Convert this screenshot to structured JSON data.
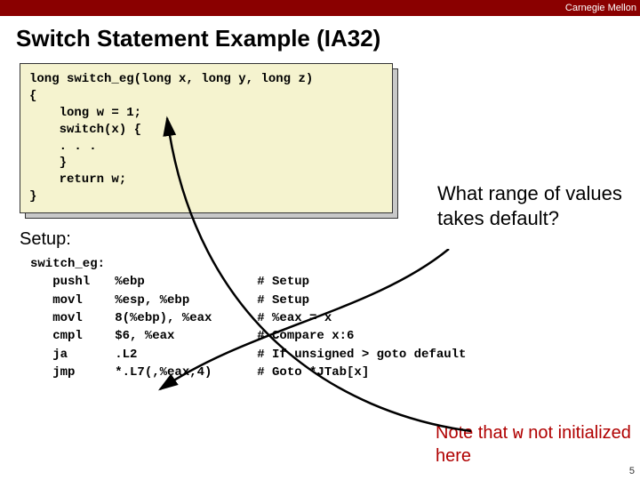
{
  "brand": "Carnegie Mellon",
  "title": "Switch Statement Example (IA32)",
  "code": {
    "l1": "long switch_eg(long x, long y, long z)",
    "l2": "{",
    "l3": "    long w = 1;",
    "l4": "    switch(x) {",
    "l5": "    . . .",
    "l6": "    }",
    "l7": "    return w;",
    "l8": "}"
  },
  "question": "What range of values takes default?",
  "setup_label": "Setup:",
  "asm": {
    "label": "switch_eg:",
    "rows": [
      {
        "op": "pushl",
        "args": "%ebp",
        "cmt": "# Setup"
      },
      {
        "op": "movl",
        "args": "%esp, %ebp",
        "cmt": "# Setup"
      },
      {
        "op": "movl",
        "args": "8(%ebp), %eax",
        "cmt": "# %eax = x"
      },
      {
        "op": "cmpl",
        "args": "$6, %eax",
        "cmt": "# Compare x:6"
      },
      {
        "op": "ja",
        "args": ".L2",
        "cmt": "# If unsigned > goto default"
      },
      {
        "op": "jmp",
        "args": "*.L7(,%eax,4)",
        "cmt": "# Goto *JTab[x]"
      }
    ]
  },
  "note_pre": "Note that ",
  "note_var": "w",
  "note_post": " not initialized here",
  "page": "5"
}
